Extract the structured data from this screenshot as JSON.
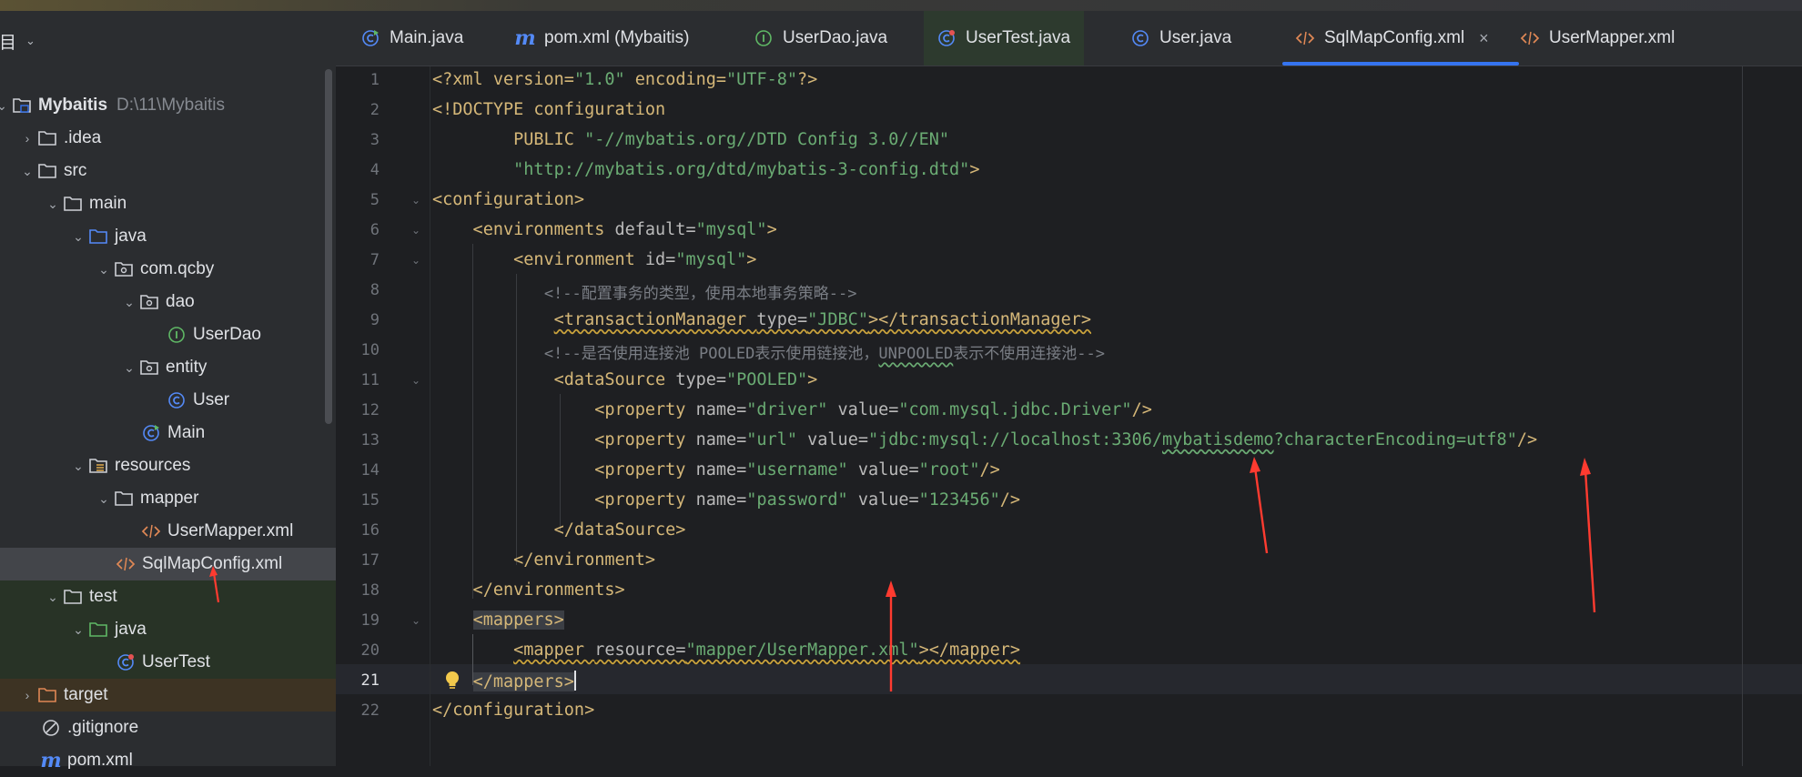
{
  "panel": {
    "title": "项目",
    "tree": [
      {
        "label": "Mybaitis",
        "path": "D:\\11\\Mybaitis"
      },
      {
        "label": ".idea"
      },
      {
        "label": "src"
      },
      {
        "label": "main"
      },
      {
        "label": "java"
      },
      {
        "label": "com.qcby"
      },
      {
        "label": "dao"
      },
      {
        "label": "UserDao"
      },
      {
        "label": "entity"
      },
      {
        "label": "User"
      },
      {
        "label": "Main"
      },
      {
        "label": "resources"
      },
      {
        "label": "mapper"
      },
      {
        "label": "UserMapper.xml"
      },
      {
        "label": "SqlMapConfig.xml"
      },
      {
        "label": "test"
      },
      {
        "label": "java"
      },
      {
        "label": "UserTest"
      },
      {
        "label": "target"
      },
      {
        "label": ".gitignore"
      },
      {
        "label": "pom.xml"
      }
    ]
  },
  "tabs": [
    {
      "label": "Main.java"
    },
    {
      "label": "pom.xml (Mybaitis)"
    },
    {
      "label": "UserDao.java"
    },
    {
      "label": "UserTest.java"
    },
    {
      "label": "User.java"
    },
    {
      "label": "SqlMapConfig.xml",
      "close": "×"
    },
    {
      "label": "UserMapper.xml"
    }
  ],
  "editor": {
    "line_numbers": [
      "1",
      "2",
      "3",
      "4",
      "5",
      "6",
      "7",
      "8",
      "9",
      "10",
      "11",
      "12",
      "13",
      "14",
      "15",
      "16",
      "17",
      "18",
      "19",
      "20",
      "21",
      "22"
    ],
    "current_line": 21,
    "lines": {
      "l1": {
        "p1": "<?xml version=",
        "p2": "\"1.0\"",
        "p3": " encoding=",
        "p4": "\"UTF-8\"",
        "p5": "?>"
      },
      "l2": {
        "p1": "<!DOCTYPE configuration"
      },
      "l3": {
        "p1": "        PUBLIC ",
        "p2": "\"-//mybatis.org//DTD Config 3.0//EN\""
      },
      "l4": {
        "p1": "        ",
        "p2": "\"http://mybatis.org/dtd/mybatis-3-config.dtd\"",
        "p3": ">"
      },
      "l5": {
        "p1": "<configuration>"
      },
      "l6": {
        "p1": "    <environments ",
        "p2": "default=",
        "p3": "\"mysql\"",
        "p4": ">"
      },
      "l7": {
        "p1": "        <environment ",
        "p2": "id=",
        "p3": "\"mysql\"",
        "p4": ">"
      },
      "l8": {
        "p1": "            <!--配置事务的类型，使用本地事务策略-->"
      },
      "l9": {
        "p1": "<transactionManager ",
        "p2": "type=",
        "p3": "\"JDBC\"",
        "p4": "></transactionManager>"
      },
      "l10": {
        "p1": "            <!--是否使用连接池 POOLED表示使用链接池，",
        "p2": "UNPOOLED",
        "p3": "表示不使用连接池-->"
      },
      "l11": {
        "p1": "            <dataSource ",
        "p2": "type=",
        "p3": "\"POOLED\"",
        "p4": ">"
      },
      "l12": {
        "p1": "                <property ",
        "p2": "name=",
        "p3": "\"driver\"",
        "p4": " value=",
        "p5": "\"com.mysql.jdbc.Driver\"",
        "p6": "/>"
      },
      "l13": {
        "p1": "                <property ",
        "p2": "name=",
        "p3": "\"url\"",
        "p4": " value=",
        "p5": "\"jdbc:mysql://localhost:3306/",
        "p6": "mybatisdemo",
        "p7": "?characterEncoding=utf8\"",
        "p8": "/>"
      },
      "l14": {
        "p1": "                <property ",
        "p2": "name=",
        "p3": "\"username\"",
        "p4": " value=",
        "p5": "\"root\"",
        "p6": "/>"
      },
      "l15": {
        "p1": "                <property ",
        "p2": "name=",
        "p3": "\"password\"",
        "p4": " value=",
        "p5": "\"123456\"",
        "p6": "/>"
      },
      "l16": {
        "p1": "            </dataSource>"
      },
      "l17": {
        "p1": "        </environment>"
      },
      "l18": {
        "p1": "    </environments>"
      },
      "l19": {
        "p1": "<mappers>"
      },
      "l20": {
        "p1": "<mapper ",
        "p2": "resource=",
        "p3": "\"mapper/UserMapper.xml\"",
        "p4": "></mapper>"
      },
      "l21": {
        "p1": "</mappers>"
      },
      "l22": {
        "p1": "</configuration>"
      }
    }
  },
  "colors": {
    "tag": "#d5b778",
    "attr_value": "#6aab73",
    "comment": "#7a7e85",
    "annotation_arrow": "#ff3b30",
    "accent": "#3574f0"
  }
}
